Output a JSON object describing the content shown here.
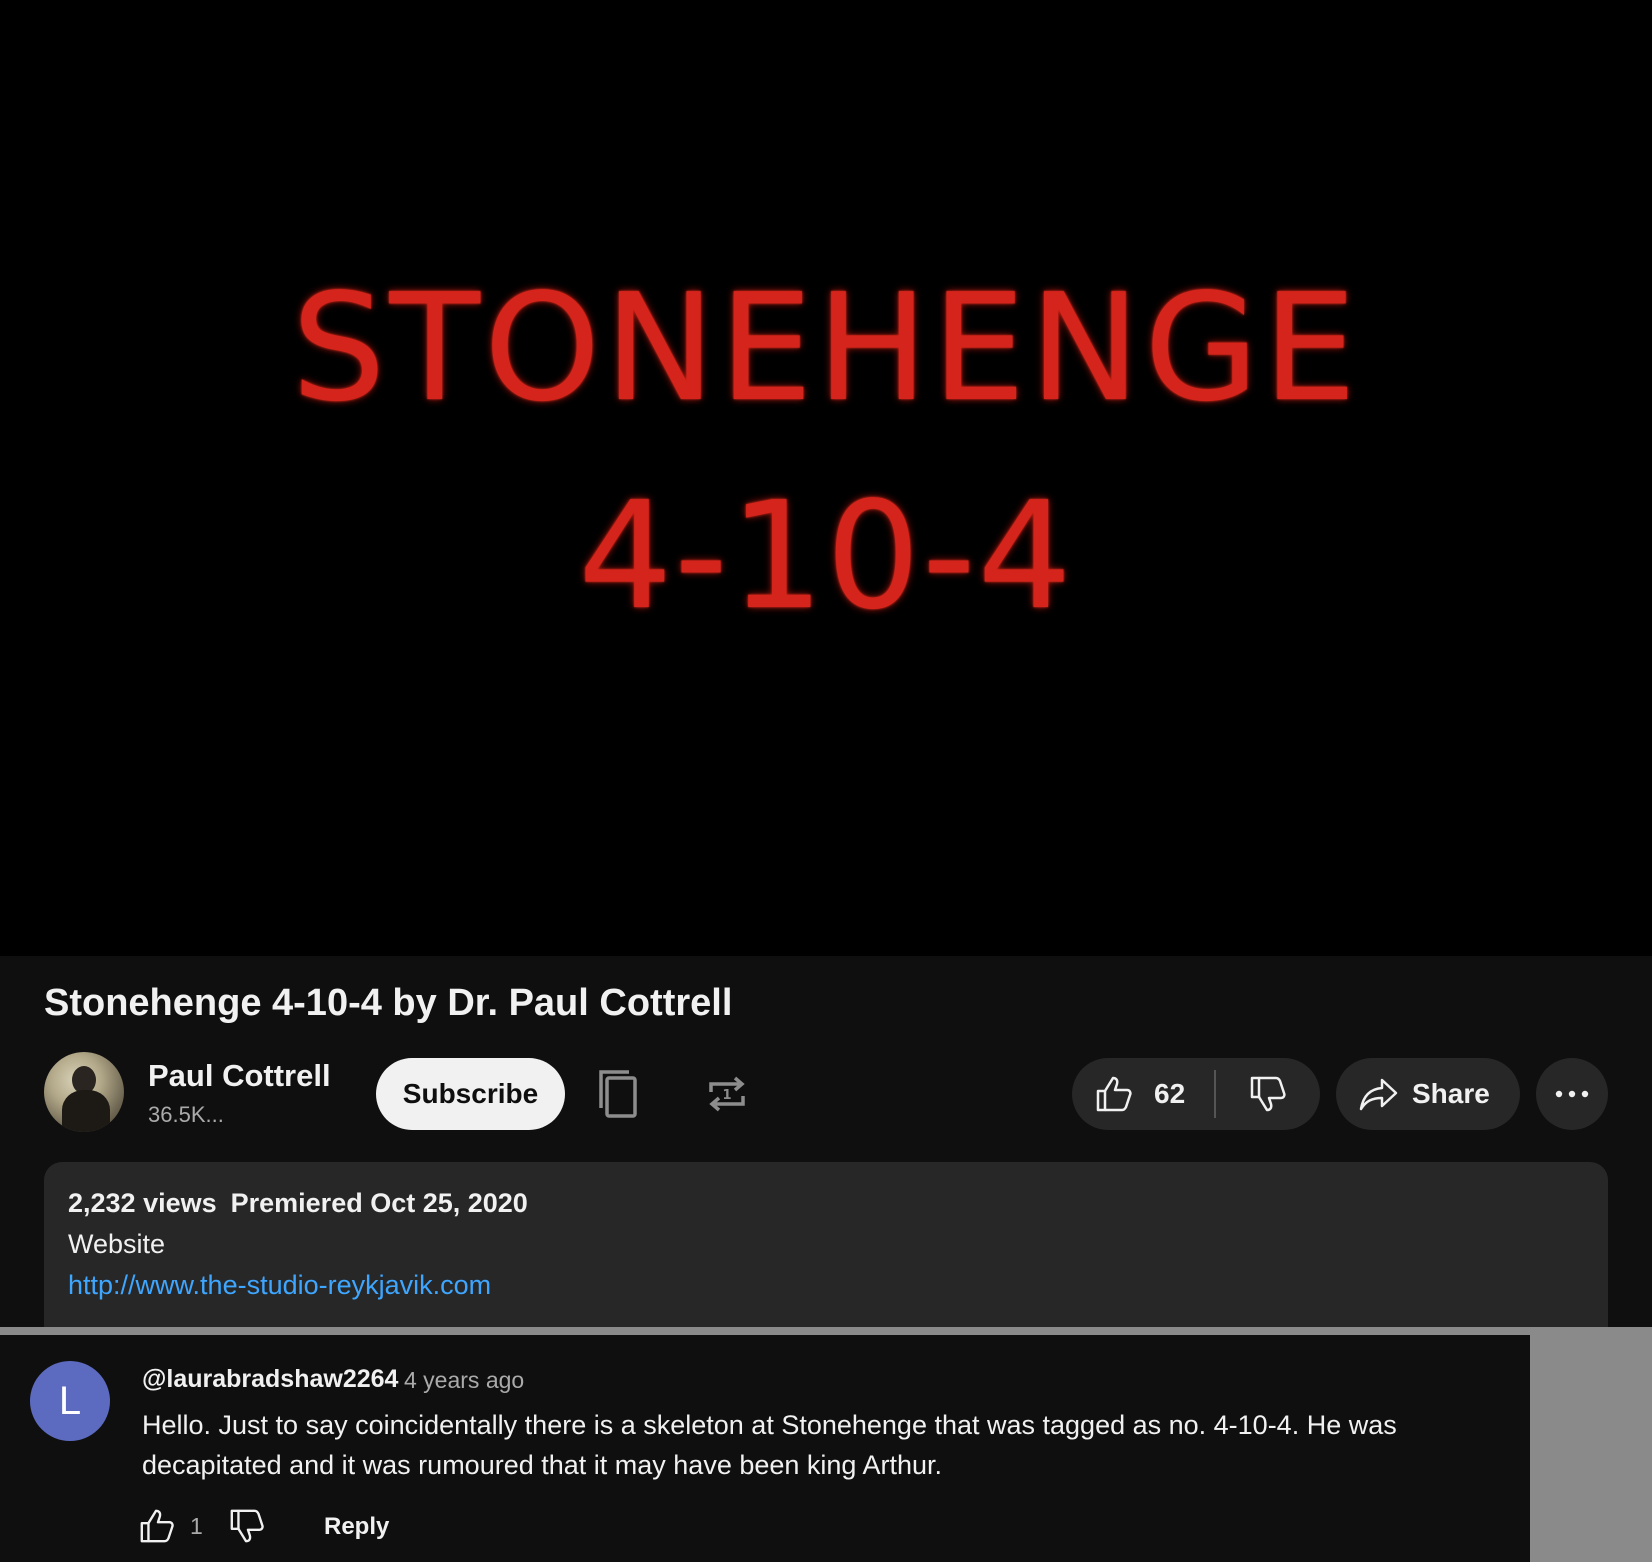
{
  "player": {
    "line1": "STONEHENGE",
    "line2": "4-10-4"
  },
  "video": {
    "title": "Stonehenge 4-10-4 by Dr. Paul Cottrell"
  },
  "channel": {
    "name": "Paul Cottrell",
    "subscribers": "36.5K..."
  },
  "actions": {
    "subscribe_label": "Subscribe",
    "like_count": "62",
    "share_label": "Share"
  },
  "description": {
    "views": "2,232 views",
    "premiered": "Premiered Oct 25, 2020",
    "line": "Website",
    "link": "http://www.the-studio-reykjavik.com"
  },
  "comment": {
    "avatar_letter": "L",
    "author": "@laurabradshaw2264",
    "time": "4 years ago",
    "text": "Hello. Just to say coincidentally there is a skeleton at Stonehenge that was tagged as no. 4-10-4. He was decapitated and it was rumoured that it may have been king Arthur.",
    "like_count": "1",
    "reply_label": "Reply"
  },
  "colors": {
    "background": "#0f0f0f",
    "surface": "#272727",
    "link": "#3ea6ff",
    "video_text": "#d4241b",
    "comment_avatar": "#5c6bc0"
  }
}
